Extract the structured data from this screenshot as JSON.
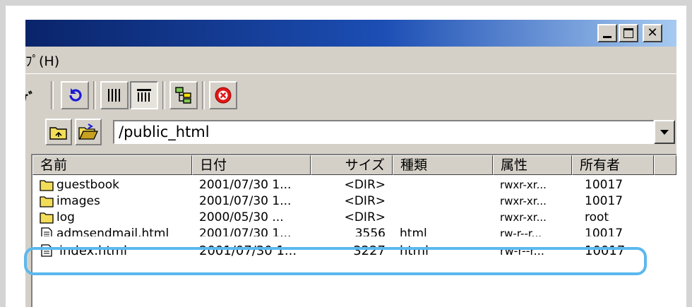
{
  "menubar": {
    "help_label": "ﾌﾟ(H)"
  },
  "toolbar": {
    "partial_label": "ｹﾞ"
  },
  "address": {
    "path": "/public_html"
  },
  "columns": [
    "名前",
    "日付",
    "サイズ",
    "種類",
    "属性",
    "所有者"
  ],
  "files": [
    {
      "name": "guestbook",
      "date": "2001/07/30 1...",
      "size": "<DIR>",
      "type": "",
      "attr": "rwxr-xr...",
      "owner": "10017",
      "icon": "folder-icon"
    },
    {
      "name": "images",
      "date": "2001/07/30 1...",
      "size": "<DIR>",
      "type": "",
      "attr": "rwxr-xr...",
      "owner": "10017",
      "icon": "folder-icon"
    },
    {
      "name": "log",
      "date": "2000/05/30   ...",
      "size": "<DIR>",
      "type": "",
      "attr": "rwxr-xr...",
      "owner": "root",
      "icon": "folder-icon"
    },
    {
      "name": "admsendmail.html",
      "date": "2001/07/30 1...",
      "size": "3556",
      "type": "html",
      "attr": "rw-r--r...",
      "owner": "10017",
      "icon": "file-icon"
    },
    {
      "name": "index.html",
      "date": "2001/07/30 1...",
      "size": "3227",
      "type": "html",
      "attr": "rw-r--r...",
      "owner": "10017",
      "icon": "file-icon"
    }
  ],
  "colors": {
    "titlebar_start": "#0a246a",
    "titlebar_end": "#a6caf0",
    "highlight": "#5bb8ee",
    "window_face": "#d4d0c8"
  }
}
